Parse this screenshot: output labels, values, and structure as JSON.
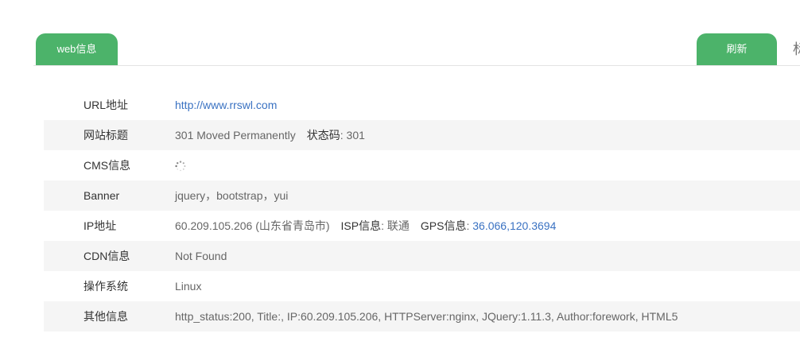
{
  "tabs": {
    "web_label": "web信息",
    "refresh_label": "刷新",
    "cut_char": "标"
  },
  "rows": [
    {
      "label": "URL地址",
      "url": "http://www.rrswl.com"
    },
    {
      "label": "网站标题",
      "title": "301 Moved Permanently",
      "status_key": "状态码",
      "status_value": "301"
    },
    {
      "label": "CMS信息",
      "state_icon": "loading-spinner-icon"
    },
    {
      "label": "Banner",
      "value": "jquery，bootstrap，yui"
    },
    {
      "label": "IP地址",
      "ip": "60.209.105.206",
      "location": "(山东省青岛市)",
      "isp_key": "ISP信息",
      "isp_value": "联通",
      "gps_key": "GPS信息",
      "gps_value": "36.066,120.3694"
    },
    {
      "label": "CDN信息",
      "value": "Not Found"
    },
    {
      "label": "操作系统",
      "value": "Linux"
    },
    {
      "label": "其他信息",
      "value": "http_status:200, Title:, IP:60.209.105.206, HTTPServer:nginx, JQuery:1.11.3, Author:forework, HTML5"
    }
  ],
  "colors": {
    "accent": "#4cb36a",
    "link": "#3a72c2",
    "row_alt": "#f5f5f5"
  }
}
